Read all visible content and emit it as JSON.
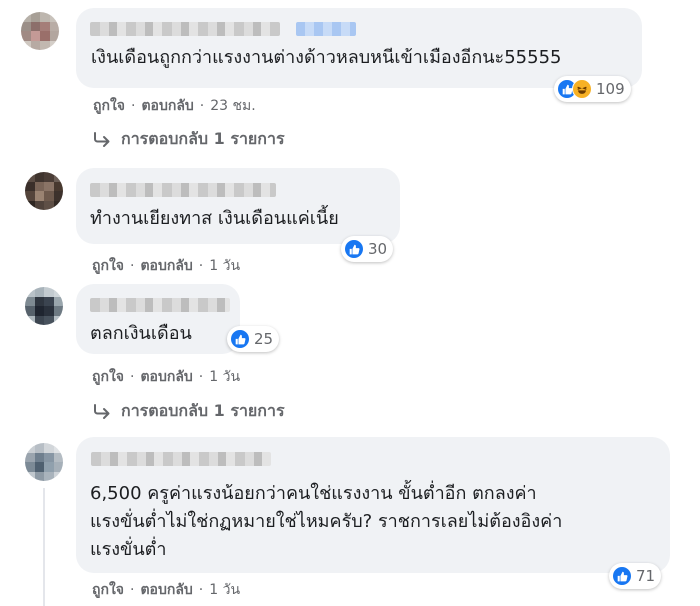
{
  "comments": [
    {
      "text_lines": [
        "เงินเดือนถูกกว่าแรงงานต่างด้าวหลบหนีเข้าเมืองอีกนะ55555"
      ],
      "reaction_count": "109",
      "reaction_icons": [
        "like-icon",
        "haha-icon"
      ],
      "like_label": "ถูกใจ",
      "reply_label": "ตอบกลับ",
      "time": "23 ชม.",
      "view_replies_label": "การตอบกลับ 1 รายการ"
    },
    {
      "text_lines": [
        "ทำงานเยียงทาส เงินเดือนแค่เนี้ย"
      ],
      "reaction_count": "30",
      "reaction_icons": [
        "like-icon"
      ],
      "like_label": "ถูกใจ",
      "reply_label": "ตอบกลับ",
      "time": "1 วัน"
    },
    {
      "text_lines": [
        "ตลกเงินเดือน"
      ],
      "reaction_count": "25",
      "reaction_icons": [
        "like-icon"
      ],
      "like_label": "ถูกใจ",
      "reply_label": "ตอบกลับ",
      "time": "1 วัน",
      "view_replies_label": "การตอบกลับ 1 รายการ"
    },
    {
      "text_lines": [
        "6,500 ครูค่าแรงน้อยกว่าคนใช่แรงงาน ขั้นต่ำอีก ตกลงค่า",
        "แรงขั่นต่ำไม่ใช่กฏหมายใช่ไหมครับ? ราชการเลยไม่ต้องอิงค่า",
        "แรงขั่นต่ำ"
      ],
      "reaction_count": "71",
      "reaction_icons": [
        "like-icon"
      ],
      "like_label": "ถูกใจ",
      "reply_label": "ตอบกลับ",
      "time": "1 วัน"
    }
  ],
  "separator": "·",
  "colors": {
    "bubble": "#f0f2f5",
    "meta_text": "#65676b",
    "like_blue": "#1877f2",
    "haha_yellow": "#f7b125"
  }
}
